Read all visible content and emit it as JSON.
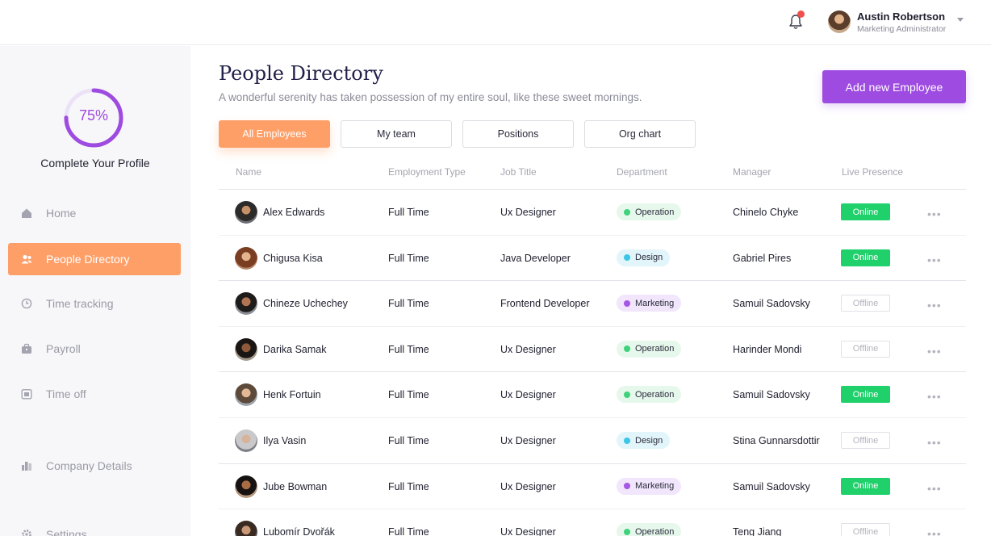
{
  "header": {
    "user_name": "Austin Robertson",
    "user_role": "Marketing Administrator",
    "notification_icon": "bell-icon"
  },
  "profile": {
    "progress_percent": 75,
    "progress_label": "75%",
    "complete_label": "Complete Your Profile"
  },
  "sidebar": {
    "items": [
      {
        "label": "Home",
        "icon": "home-icon",
        "active": false
      },
      {
        "label": "People Directory",
        "icon": "people-icon",
        "active": true
      },
      {
        "label": "Time tracking",
        "icon": "clock-icon",
        "active": false
      },
      {
        "label": "Payroll",
        "icon": "wallet-icon",
        "active": false
      },
      {
        "label": "Time off",
        "icon": "calendar-icon",
        "active": false
      },
      {
        "label": "Company Details",
        "icon": "building-icon",
        "active": false
      },
      {
        "label": "Settings",
        "icon": "gear-icon",
        "active": false
      }
    ]
  },
  "main": {
    "title": "People Directory",
    "subtitle": "A wonderful serenity has taken possession of my entire soul, like these sweet mornings.",
    "add_button": "Add new Employee",
    "tabs": [
      {
        "label": "All Employees",
        "active": true
      },
      {
        "label": "My team",
        "active": false
      },
      {
        "label": "Positions",
        "active": false
      },
      {
        "label": "Org chart",
        "active": false
      }
    ]
  },
  "table": {
    "columns": [
      "Name",
      "Employment Type",
      "Job Title",
      "Department",
      "Manager",
      "Live Presence"
    ],
    "rows": [
      {
        "name": "Alex Edwards",
        "type": "Full Time",
        "title": "Ux Designer",
        "department": "Operation",
        "manager": "Chinelo Chyke",
        "presence": "Online"
      },
      {
        "name": "Chigusa Kisa",
        "type": "Full Time",
        "title": "Java Developer",
        "department": "Design",
        "manager": "Gabriel Pires",
        "presence": "Online"
      },
      {
        "name": "Chineze Uchechey",
        "type": "Full Time",
        "title": "Frontend Developer",
        "department": "Marketing",
        "manager": "Samuil Sadovsky",
        "presence": "Offline"
      },
      {
        "name": "Darika Samak",
        "type": "Full Time",
        "title": "Ux Designer",
        "department": "Operation",
        "manager": "Harinder Mondi",
        "presence": "Offline"
      },
      {
        "name": "Henk Fortuin",
        "type": "Full Time",
        "title": "Ux Designer",
        "department": "Operation",
        "manager": "Samuil Sadovsky",
        "presence": "Online"
      },
      {
        "name": "Ilya Vasin",
        "type": "Full Time",
        "title": "Ux Designer",
        "department": "Design",
        "manager": "Stina Gunnarsdottir",
        "presence": "Offline"
      },
      {
        "name": "Jube Bowman",
        "type": "Full Time",
        "title": "Ux Designer",
        "department": "Marketing",
        "manager": "Samuil Sadovsky",
        "presence": "Online"
      },
      {
        "name": "Lubomír Dvořák",
        "type": "Full Time",
        "title": "Ux Designer",
        "department": "Operation",
        "manager": "Teng Jiang",
        "presence": "Offline"
      }
    ],
    "more_label": "•••"
  },
  "colors": {
    "accent_purple": "#9d4be0",
    "accent_orange": "#fe9f68",
    "online_green": "#20d06b",
    "dept_operation": "#3fd27a",
    "dept_design": "#3cc6e6",
    "dept_marketing": "#a557e5"
  }
}
